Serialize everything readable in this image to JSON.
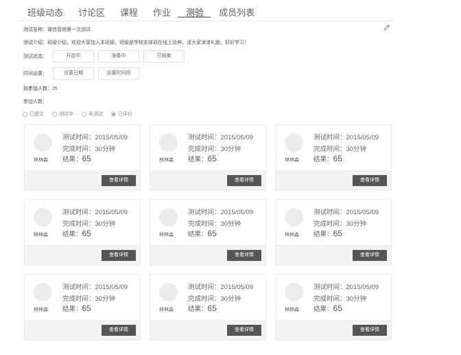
{
  "tabs": [
    {
      "label": "班级动态",
      "active": false
    },
    {
      "label": "讨论区",
      "active": false
    },
    {
      "label": "课程",
      "active": false
    },
    {
      "label": "作业",
      "active": false
    },
    {
      "label": "测验",
      "active": true
    },
    {
      "label": "成员列表",
      "active": false
    }
  ],
  "test": {
    "name_label": "测试名称：",
    "name_value": "微信营销第一次测试",
    "intro_label": "测试介绍：",
    "intro_value": "班级介绍，欢迎大家加入本班级，班级是学校实体班在线上延伸，请大家津津礼貌，好好学习！",
    "status_label": "测试状态：",
    "status_options": [
      "开启中",
      "准备中",
      "已结束"
    ],
    "time_label": "时间设置：",
    "time_options": [
      "设置日期",
      "设置时间段"
    ],
    "expected_label": "拟参加人数：",
    "expected_value": "25",
    "participants_label": "参加人数：",
    "filters": [
      {
        "label": "已提交",
        "checked": false
      },
      {
        "label": "测试中",
        "checked": false
      },
      {
        "label": "未测试",
        "checked": false
      },
      {
        "label": "已评价",
        "checked": true
      }
    ]
  },
  "cards": [
    {
      "name": "林林森",
      "test_time": "测试时间：2015/05/09",
      "duration": "完成时间：30分钟",
      "result_label": "结果：",
      "score": "65",
      "button": "查看详情"
    },
    {
      "name": "林林森",
      "test_time": "测试时间：2015/05/09",
      "duration": "完成时间：30分钟",
      "result_label": "结果：",
      "score": "65",
      "button": "查看详情"
    },
    {
      "name": "林林森",
      "test_time": "测试时间：2015/05/09",
      "duration": "完成时间：30分钟",
      "result_label": "结果：",
      "score": "65",
      "button": "查看详情"
    },
    {
      "name": "林林森",
      "test_time": "测试时间：2015/05/09",
      "duration": "完成时间：30分钟",
      "result_label": "结果：",
      "score": "65",
      "button": "查看详情"
    },
    {
      "name": "林林森",
      "test_time": "测试时间：2015/05/09",
      "duration": "完成时间：30分钟",
      "result_label": "结果：",
      "score": "65",
      "button": "查看详情"
    },
    {
      "name": "林林森",
      "test_time": "测试时间：2015/05/09",
      "duration": "完成时间：30分钟",
      "result_label": "结果：",
      "score": "65",
      "button": "查看详情"
    },
    {
      "name": "林林森",
      "test_time": "测试时间：2015/05/09",
      "duration": "完成时间：30分钟",
      "result_label": "结果：",
      "score": "65",
      "button": "查看详情"
    },
    {
      "name": "林林森",
      "test_time": "测试时间：2015/05/09",
      "duration": "完成时间：30分钟",
      "result_label": "结果：",
      "score": "65",
      "button": "查看详情"
    },
    {
      "name": "林林森",
      "test_time": "测试时间：2015/05/09",
      "duration": "完成时间：30分钟",
      "result_label": "结果：",
      "score": "65",
      "button": "查看详情"
    }
  ]
}
